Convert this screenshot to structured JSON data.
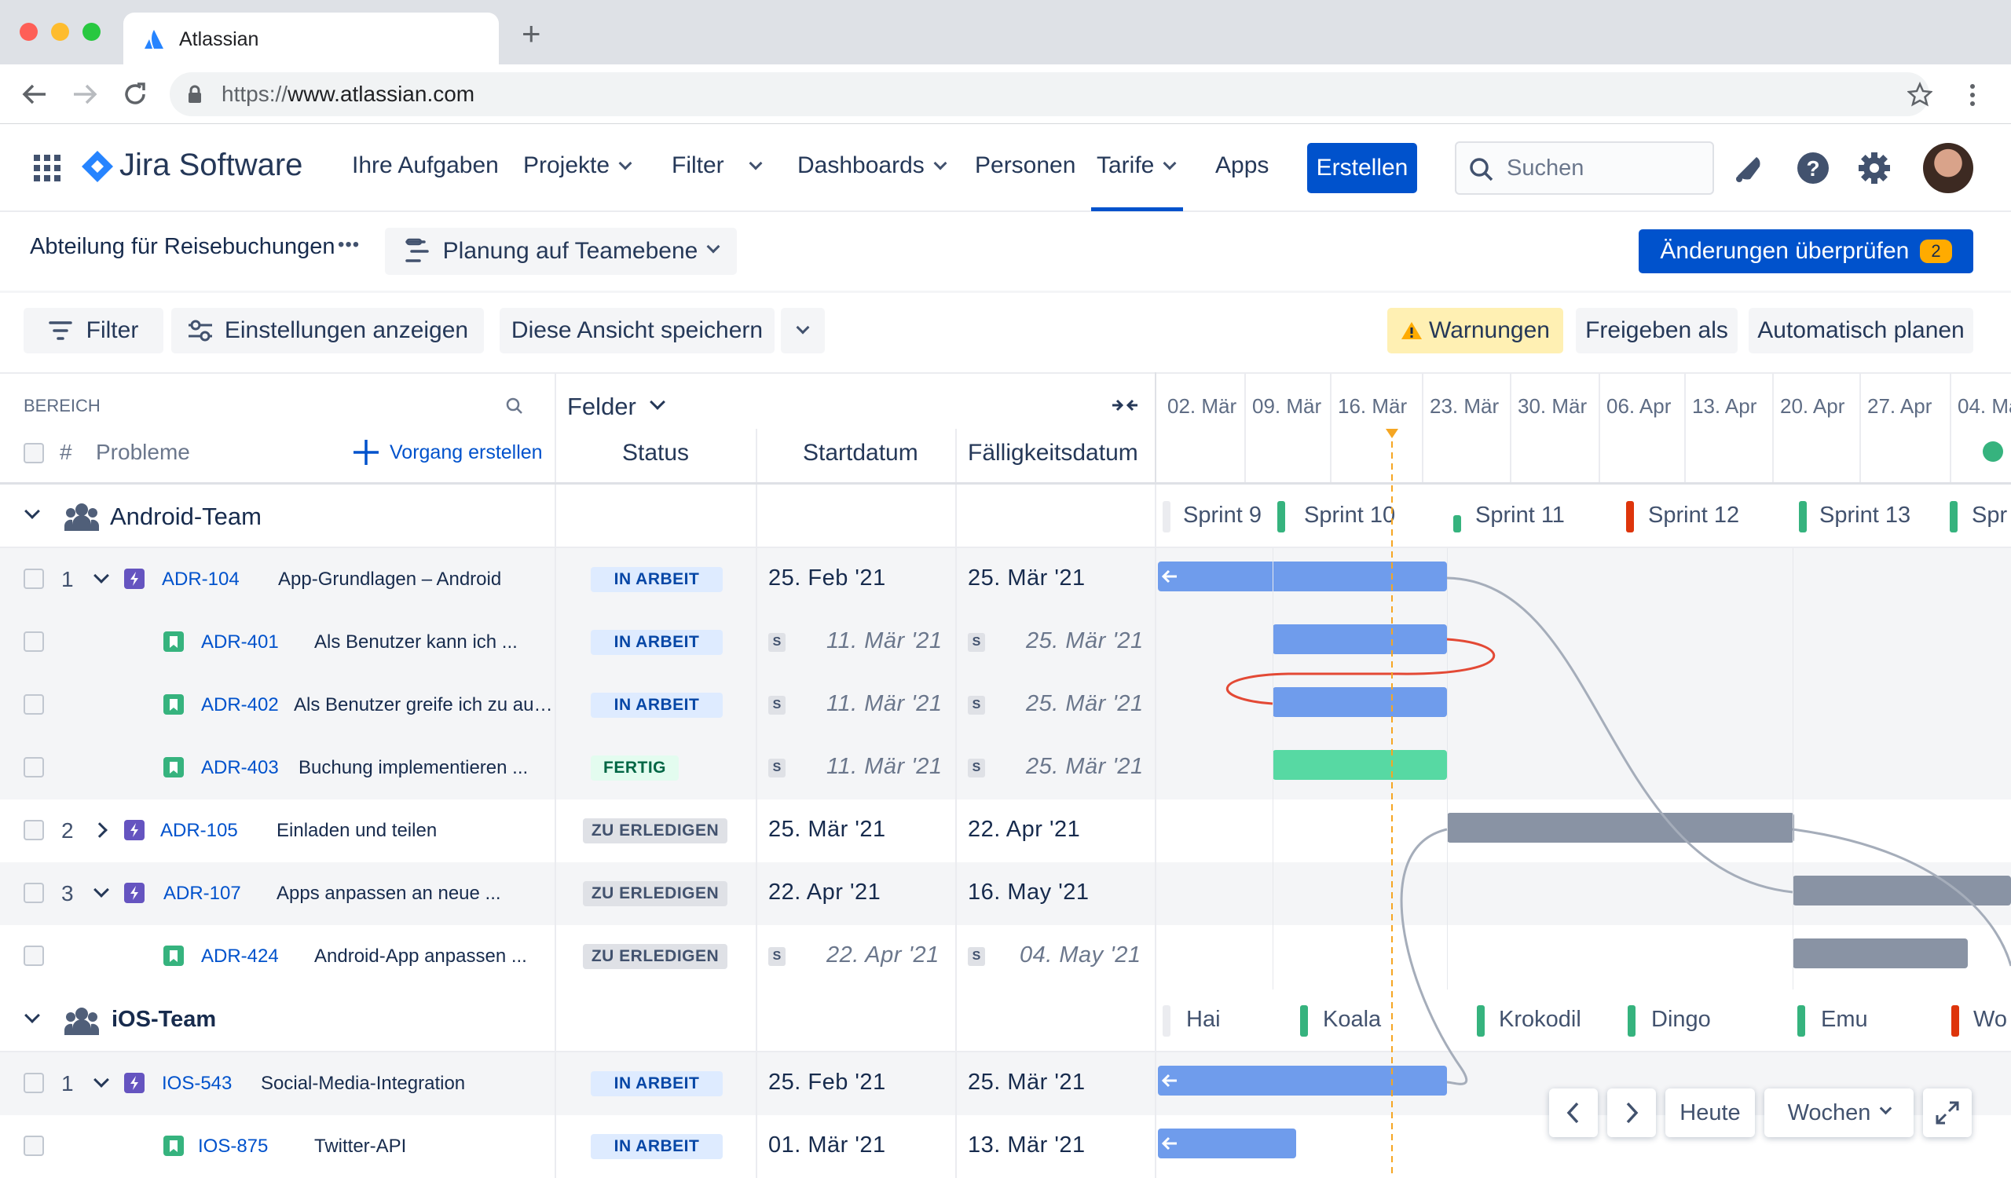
{
  "browser": {
    "tab_title": "Atlassian",
    "new_tab": "+",
    "url_prefix": "https://",
    "url_domain": "www.atlassian.com"
  },
  "header": {
    "product": "Jira Software",
    "nav": [
      "Ihre Aufgaben",
      "Projekte",
      "Filter",
      "Dashboards",
      "Personen",
      "Tarife",
      "Apps"
    ],
    "active_nav": "Tarife",
    "create_label": "Erstellen",
    "search_placeholder": "Suchen"
  },
  "subheader": {
    "project": "Abteilung für Reisebuchungen",
    "more": "•••",
    "plan_view": "Planung auf Teamebene",
    "review_label": "Änderungen überprüfen",
    "review_count": "2"
  },
  "toolbar": {
    "filter": "Filter",
    "settings": "Einstellungen anzeigen",
    "save_view": "Diese Ansicht speichern",
    "warnings": "Warnungen",
    "share": "Freigeben als",
    "autoplan": "Automatisch planen"
  },
  "table_header": {
    "scope": "BEREICH",
    "hash": "#",
    "issues": "Probleme",
    "create_issue": "Vorgang erstellen",
    "fields": "Felder",
    "status": "Status",
    "start": "Startdatum",
    "due": "Fälligkeitsdatum"
  },
  "weeks": [
    "02. Mär",
    "09. Mär",
    "16. Mär",
    "23. Mär",
    "30. Mär",
    "06. Apr",
    "13. Apr",
    "20. Apr",
    "27. Apr",
    "04. Ma"
  ],
  "teams": [
    {
      "name": "Android-Team",
      "sprints": [
        "Sprint 9",
        "Sprint 10",
        "Sprint 11",
        "Sprint 12",
        "Sprint 13",
        "Spr"
      ]
    },
    {
      "name": "iOS-Team",
      "sprints": [
        "Hai",
        "Koala",
        "Krokodil",
        "Dingo",
        "Emu",
        "Wo"
      ]
    }
  ],
  "rows": [
    {
      "num": "1",
      "key": "ADR-104",
      "summary": "App-Grundlagen – Android",
      "status": "IN ARBEIT",
      "start": "25. Feb '21",
      "due": "25. Mär '21"
    },
    {
      "num": "",
      "key": "ADR-401",
      "summary": "Als Benutzer kann ich ...",
      "status": "IN ARBEIT",
      "start": "11. Mär '21",
      "due": "25. Mär '21",
      "s": "S"
    },
    {
      "num": "",
      "key": "ADR-402",
      "summary": "Als Benutzer greife ich zu auf ...",
      "status": "IN ARBEIT",
      "start": "11. Mär '21",
      "due": "25. Mär '21",
      "s": "S"
    },
    {
      "num": "",
      "key": "ADR-403",
      "summary": "Buchung implementieren ...",
      "status": "FERTIG",
      "start": "11. Mär '21",
      "due": "25. Mär '21",
      "s": "S"
    },
    {
      "num": "2",
      "key": "ADR-105",
      "summary": "Einladen und teilen",
      "status": "ZU ERLEDIGEN",
      "start": "25. Mär '21",
      "due": "22. Apr '21"
    },
    {
      "num": "3",
      "key": "ADR-107",
      "summary": "Apps anpassen an neue ...",
      "status": "ZU ERLEDIGEN",
      "start": "22. Apr '21",
      "due": "16. May '21"
    },
    {
      "num": "",
      "key": "ADR-424",
      "summary": "Android-App anpassen ...",
      "status": "ZU ERLEDIGEN",
      "start": "22. Apr '21",
      "due": "04. May '21",
      "s": "S"
    },
    {
      "num": "1",
      "key": "IOS-543",
      "summary": "Social-Media-Integration",
      "status": "IN ARBEIT",
      "start": "25. Feb '21",
      "due": "25. Mär '21"
    },
    {
      "num": "",
      "key": "IOS-875",
      "summary": "Twitter-API",
      "status": "IN ARBEIT",
      "start": "01. Mär '21",
      "due": "13. Mär '21"
    }
  ],
  "controls": {
    "today": "Heute",
    "scale": "Wochen"
  },
  "colors": {
    "accent": "#0052cc",
    "bar_progress": "#6f9cec",
    "bar_done": "#57d9a3",
    "bar_todo": "#8993a4",
    "today_line": "#f5a623",
    "warning_bg": "#fff0b3"
  }
}
